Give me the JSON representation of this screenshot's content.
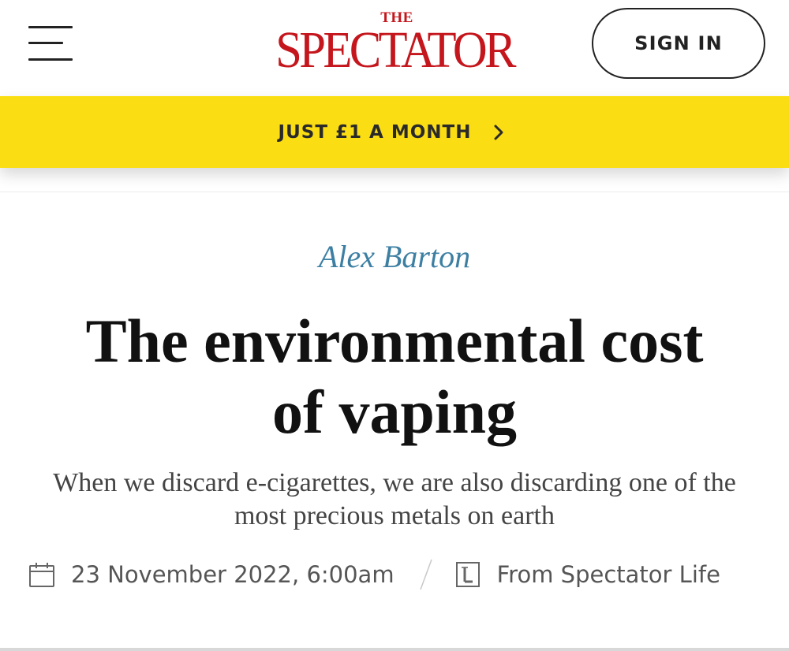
{
  "header": {
    "logo_small": "THE",
    "logo_main": "SPECTATOR",
    "signin_label": "SIGN IN",
    "logo_color": "#c4161c"
  },
  "promo": {
    "text": "JUST £1 A MONTH",
    "background": "#fbdd13"
  },
  "article": {
    "author": "Alex Barton",
    "author_color": "#3d7fa3",
    "headline_line1": "The environmental cost",
    "headline_line2": "of vaping",
    "standfirst_line1": "When we discard e-cigarettes, we are also discarding one of the",
    "standfirst_line2": "most precious metals on earth"
  },
  "meta": {
    "date": "23 November 2022, 6:00am",
    "source": "From Spectator Life",
    "icons": [
      "calendar-icon",
      "spectator-life-icon"
    ]
  }
}
